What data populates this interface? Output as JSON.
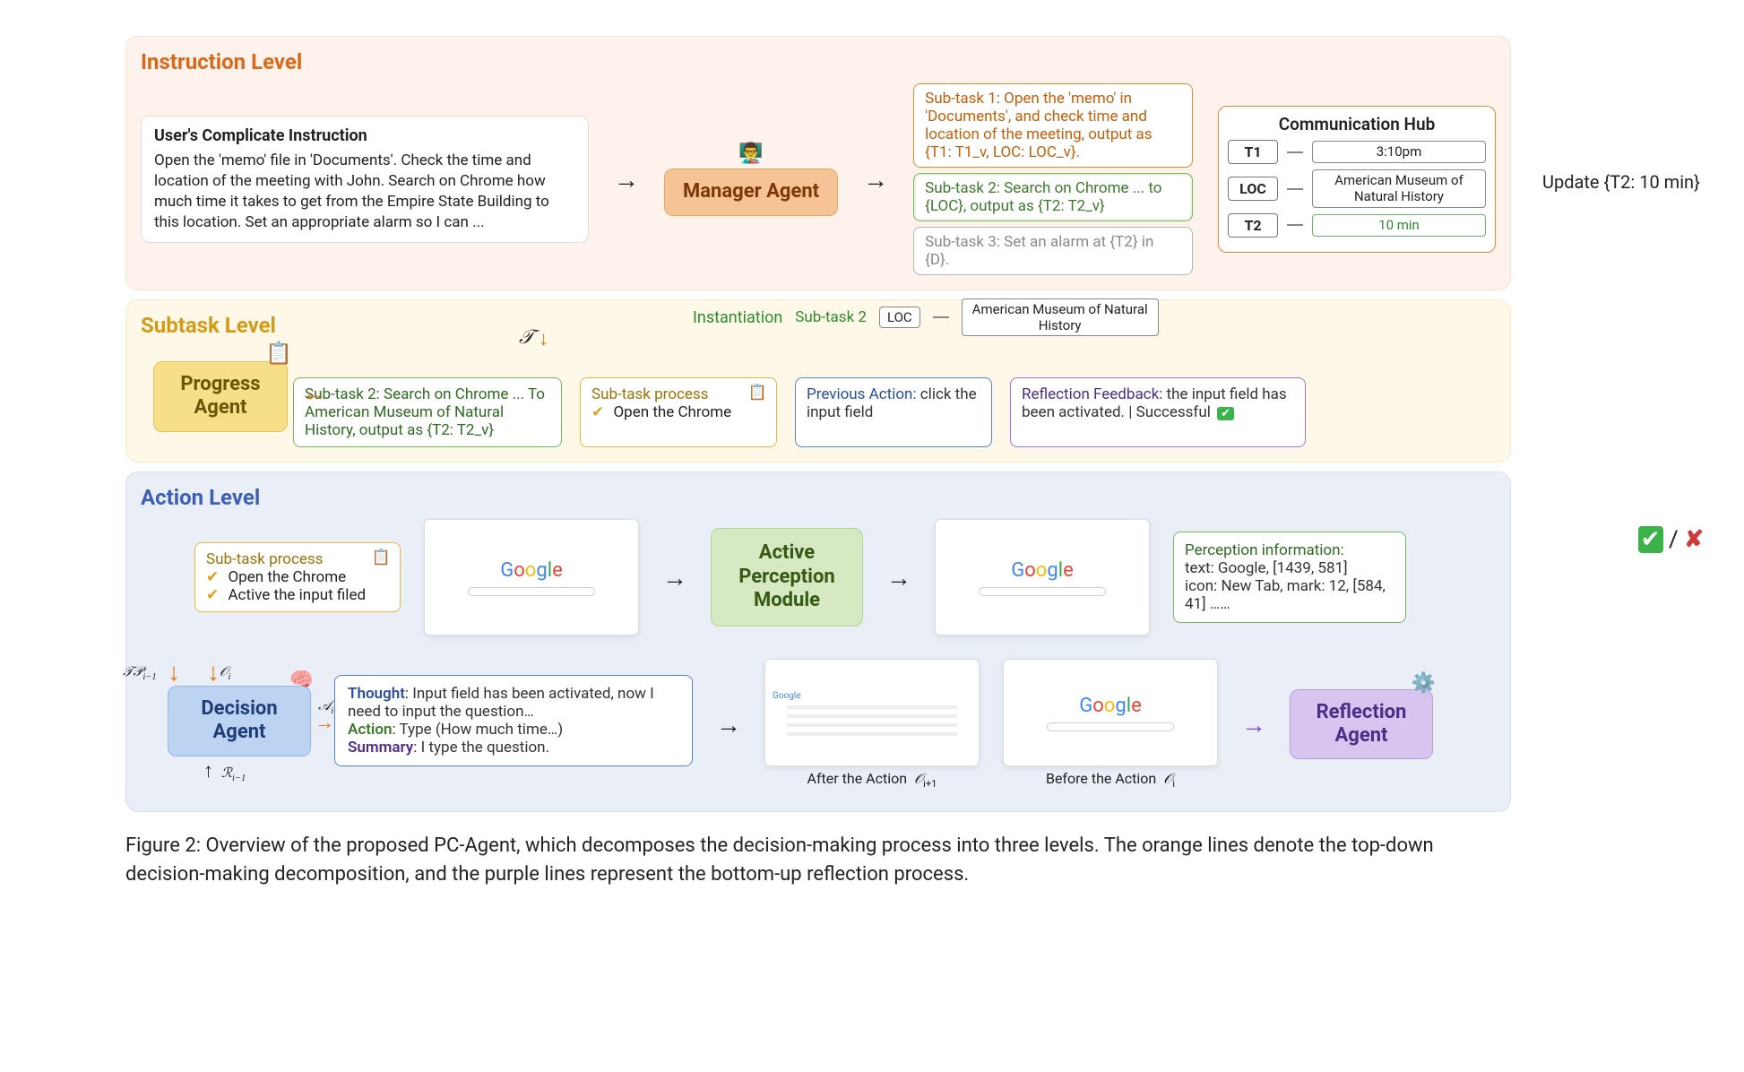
{
  "levels": {
    "instruction": "Instruction Level",
    "subtask": "Subtask Level",
    "action": "Action Level"
  },
  "user_instruction": {
    "title": "User's Complicate Instruction",
    "body": "Open the 'memo' file in 'Documents'. Check the time and location of the meeting with John. Search on Chrome how much time it takes to get from the Empire State Building to this location. Set an appropriate alarm so I can ..."
  },
  "agents": {
    "manager": "Manager Agent",
    "progress": "Progress Agent",
    "decision": "Decision Agent",
    "reflection": "Reflection Agent",
    "perception": "Active Perception Module"
  },
  "subtasks": {
    "s1": "Sub-task 1: Open the 'memo' in 'Documents', and check time and location of the meeting, output as {T1: T1_v,  LOC: LOC_v}.",
    "s2": "Sub-task 2: Search on Chrome ... to {LOC}, output as {T2: T2_v}",
    "s3": "Sub-task 3: Set an alarm at {T2} in {D}."
  },
  "comm_hub": {
    "title": "Communication Hub",
    "rows": [
      {
        "key": "T1",
        "value": "3:10pm"
      },
      {
        "key": "LOC",
        "value": "American Museum of Natural History"
      },
      {
        "key": "T2",
        "value": "10 min",
        "green": true
      }
    ]
  },
  "instantiation": {
    "label": "Instantiation",
    "subtask_label": "Sub-task 2",
    "loc_key": "LOC",
    "loc_value": "American Museum of Natural History"
  },
  "tau": "𝒯",
  "subtask_cards": {
    "green": "Sub-task 2: Search on Chrome ... To American Museum of Natural History, output as {T2: T2_v}",
    "yellow_title": "Sub-task process",
    "yellow_item1": "Open the Chrome",
    "blue_label": "Previous Action",
    "blue_body": "click the input field",
    "purple_label": "Reflection Feedback",
    "purple_body": "the input field has been activated. | Successful"
  },
  "action_level": {
    "process_title": "Sub-task process",
    "process_item1": "Open the Chrome",
    "process_item2": "Active the input filed",
    "perception_title": "Perception information:",
    "perception_body": "text: Google, [1439, 581]\nicon: New Tab, mark: 12, [584, 41] ……",
    "thought_label": "Thought",
    "thought_body": "Input field has been activated, now I need to input the question…",
    "action_label": "Action",
    "action_body": "Type (How much time…)",
    "summary_label": "Summary",
    "summary_body": "I type the question.",
    "after_label": "After the Action",
    "before_label": "Before the Action",
    "o_next": "𝒪",
    "o_next_sub": "i+1",
    "o_prev": "𝒪",
    "o_prev_sub": "i"
  },
  "side": {
    "update": "Update {T2: 10 min}",
    "check": "✔",
    "cross": "✘",
    "slash": " / "
  },
  "math_labels": {
    "tp": "𝒯𝒫",
    "tp_sub": "i−1",
    "oi": "𝒪",
    "oi_sub": "i",
    "ai": "𝒜",
    "ai_sub": "i",
    "ri": "ℛ",
    "ri_sub": "i−1"
  },
  "google": {
    "g": "G",
    "o1": "o",
    "o2": "o",
    "g2": "g",
    "l": "l",
    "e": "e"
  },
  "caption": {
    "fig": "Figure 2:",
    "text": " Overview of the proposed PC-Agent, which decomposes the decision-making process into three levels. The orange lines denote the top-down decision-making decomposition, and the purple lines represent the bottom-up reflection process."
  }
}
